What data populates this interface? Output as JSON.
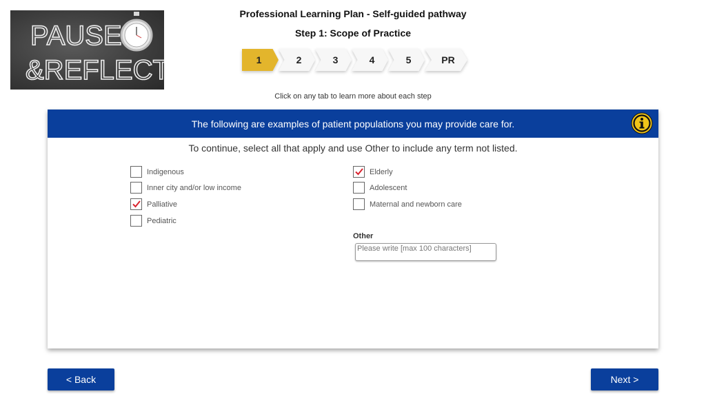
{
  "logo": {
    "line1": "PAUSE",
    "line2": "&REFLECT",
    "icon": "stopwatch-icon"
  },
  "header": {
    "title": "Professional Learning Plan - Self-guided pathway",
    "subtitle": "Step 1: Scope of Practice",
    "steps": [
      "1",
      "2",
      "3",
      "4",
      "5",
      "PR"
    ],
    "active_step": "1",
    "hint": "Click on any tab to learn more about each step"
  },
  "main": {
    "banner": "The following are examples of patient populations you may provide care for.",
    "instruction": "To continue, select all that apply and use Other to include any term not listed.",
    "options_left": [
      {
        "label": "Indigenous",
        "checked": false
      },
      {
        "label": "Inner city and/or low income",
        "checked": false
      },
      {
        "label": "Palliative",
        "checked": true
      },
      {
        "label": "Pediatric",
        "checked": false
      }
    ],
    "options_right": [
      {
        "label": "Elderly",
        "checked": true
      },
      {
        "label": "Adolescent",
        "checked": false
      },
      {
        "label": "Maternal and newborn care",
        "checked": false
      }
    ],
    "other": {
      "label": "Other",
      "placeholder": "Please write [max 100 characters]",
      "value": ""
    },
    "info_icon": "info-icon"
  },
  "nav": {
    "back_label": "< Back",
    "next_label": "Next >"
  },
  "colors": {
    "primary": "#0a3f9c",
    "active_step": "#e3b52c",
    "check": "#d9232e"
  }
}
